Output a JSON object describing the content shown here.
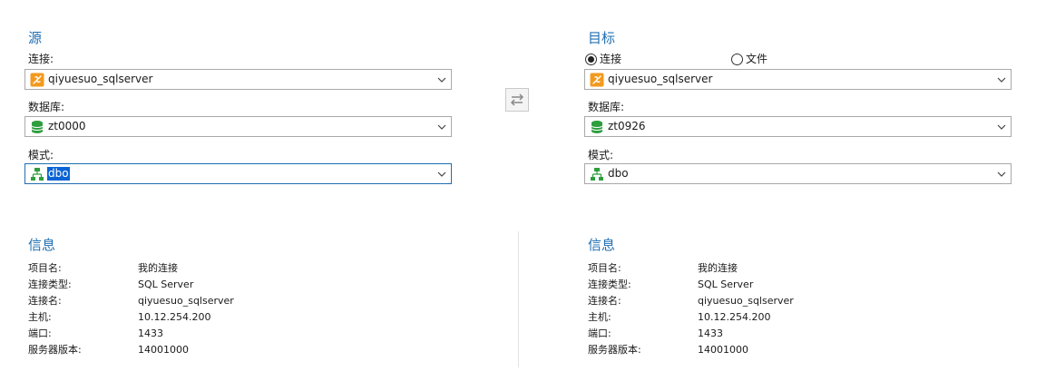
{
  "source": {
    "title": "源",
    "connection_label": "连接:",
    "connection_value": "qiyuesuo_sqlserver",
    "database_label": "数据库:",
    "database_value": "zt0000",
    "schema_label": "模式:",
    "schema_value": "dbo"
  },
  "target": {
    "title": "目标",
    "radio_connection": "连接",
    "radio_file": "文件",
    "connection_value": "qiyuesuo_sqlserver",
    "database_label": "数据库:",
    "database_value": "zt0926",
    "schema_label": "模式:",
    "schema_value": "dbo"
  },
  "source_info": {
    "title": "信息",
    "rows": [
      {
        "label": "项目名:",
        "value": "我的连接"
      },
      {
        "label": "连接类型:",
        "value": "SQL Server"
      },
      {
        "label": "连接名:",
        "value": "qiyuesuo_sqlserver"
      },
      {
        "label": "主机:",
        "value": "10.12.254.200"
      },
      {
        "label": "端口:",
        "value": "1433"
      },
      {
        "label": "服务器版本:",
        "value": "14001000"
      }
    ]
  },
  "target_info": {
    "title": "信息",
    "rows": [
      {
        "label": "项目名:",
        "value": "我的连接"
      },
      {
        "label": "连接类型:",
        "value": "SQL Server"
      },
      {
        "label": "连接名:",
        "value": "qiyuesuo_sqlserver"
      },
      {
        "label": "主机:",
        "value": "10.12.254.200"
      },
      {
        "label": "端口:",
        "value": "1433"
      },
      {
        "label": "服务器版本:",
        "value": "14001000"
      }
    ]
  },
  "icons": {
    "connection": "sql-server-connection-icon",
    "database": "database-icon",
    "schema": "schema-icon",
    "swap": "swap-arrows-icon",
    "dropdown": "chevron-down-icon"
  },
  "colors": {
    "accent": "#1f6fb2",
    "selection": "#0a64d6",
    "connection_icon": "#f29a1e",
    "database_icon": "#2e9e3e"
  }
}
